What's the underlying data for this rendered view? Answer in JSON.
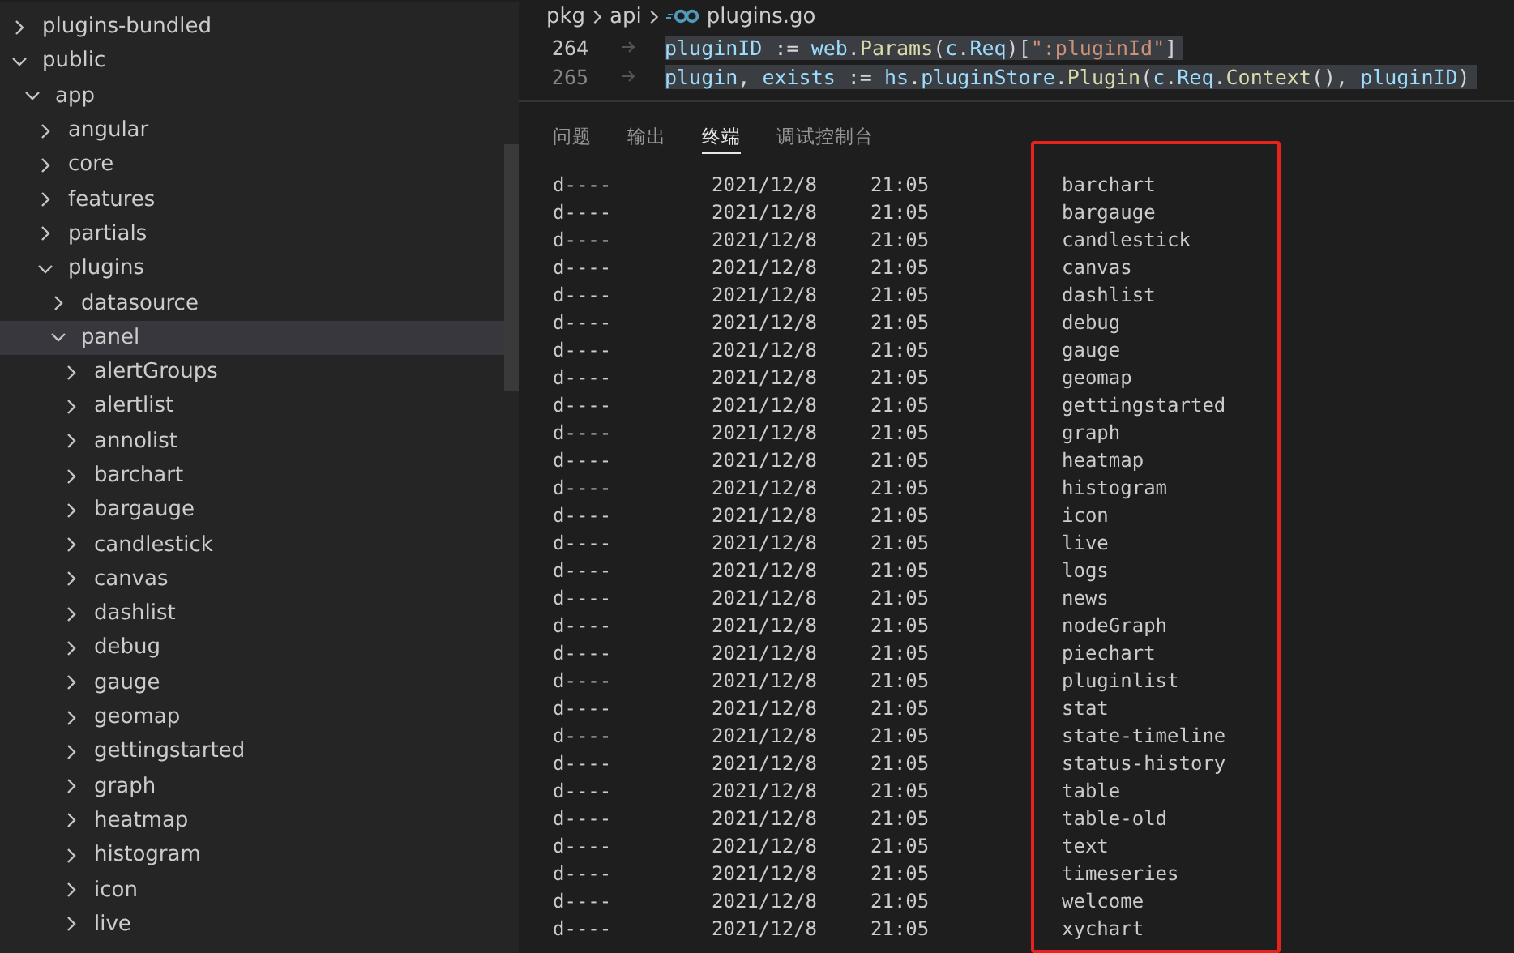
{
  "sidebar": {
    "tree": [
      {
        "label": "plugins-bundled",
        "expanded": false,
        "selected": false
      },
      {
        "label": "public",
        "expanded": true,
        "selected": false,
        "children": [
          {
            "label": "app",
            "expanded": true,
            "selected": false,
            "children": [
              {
                "label": "angular",
                "expanded": false,
                "selected": false
              },
              {
                "label": "core",
                "expanded": false,
                "selected": false
              },
              {
                "label": "features",
                "expanded": false,
                "selected": false
              },
              {
                "label": "partials",
                "expanded": false,
                "selected": false
              },
              {
                "label": "plugins",
                "expanded": true,
                "selected": false,
                "children": [
                  {
                    "label": "datasource",
                    "expanded": false,
                    "selected": false
                  },
                  {
                    "label": "panel",
                    "expanded": true,
                    "selected": true,
                    "children": [
                      {
                        "label": "alertGroups",
                        "expanded": false,
                        "selected": false
                      },
                      {
                        "label": "alertlist",
                        "expanded": false,
                        "selected": false
                      },
                      {
                        "label": "annolist",
                        "expanded": false,
                        "selected": false
                      },
                      {
                        "label": "barchart",
                        "expanded": false,
                        "selected": false
                      },
                      {
                        "label": "bargauge",
                        "expanded": false,
                        "selected": false
                      },
                      {
                        "label": "candlestick",
                        "expanded": false,
                        "selected": false
                      },
                      {
                        "label": "canvas",
                        "expanded": false,
                        "selected": false
                      },
                      {
                        "label": "dashlist",
                        "expanded": false,
                        "selected": false
                      },
                      {
                        "label": "debug",
                        "expanded": false,
                        "selected": false
                      },
                      {
                        "label": "gauge",
                        "expanded": false,
                        "selected": false
                      },
                      {
                        "label": "geomap",
                        "expanded": false,
                        "selected": false
                      },
                      {
                        "label": "gettingstarted",
                        "expanded": false,
                        "selected": false
                      },
                      {
                        "label": "graph",
                        "expanded": false,
                        "selected": false
                      },
                      {
                        "label": "heatmap",
                        "expanded": false,
                        "selected": false
                      },
                      {
                        "label": "histogram",
                        "expanded": false,
                        "selected": false
                      },
                      {
                        "label": "icon",
                        "expanded": false,
                        "selected": false
                      },
                      {
                        "label": "live",
                        "expanded": false,
                        "selected": false
                      }
                    ]
                  }
                ]
              }
            ]
          }
        ]
      }
    ]
  },
  "breadcrumb": [
    "pkg",
    "api",
    "plugins.go"
  ],
  "editor": {
    "lines": [
      {
        "number": "264",
        "tokens": [
          {
            "text": "pluginID",
            "kind": "variable"
          },
          {
            "text": " := ",
            "kind": "plain"
          },
          {
            "text": "web",
            "kind": "variable"
          },
          {
            "text": ".",
            "kind": "plain"
          },
          {
            "text": "Params",
            "kind": "function"
          },
          {
            "text": "(",
            "kind": "plain"
          },
          {
            "text": "c",
            "kind": "variable"
          },
          {
            "text": ".",
            "kind": "plain"
          },
          {
            "text": "Req",
            "kind": "variable"
          },
          {
            "text": ")[",
            "kind": "plain"
          },
          {
            "text": "\":pluginId\"",
            "kind": "string"
          },
          {
            "text": "]",
            "kind": "plain"
          }
        ]
      },
      {
        "number": "265",
        "tokens": [
          {
            "text": "plugin",
            "kind": "variable"
          },
          {
            "text": ", ",
            "kind": "plain"
          },
          {
            "text": "exists",
            "kind": "variable"
          },
          {
            "text": " := ",
            "kind": "plain"
          },
          {
            "text": "hs",
            "kind": "variable"
          },
          {
            "text": ".",
            "kind": "plain"
          },
          {
            "text": "pluginStore",
            "kind": "variable"
          },
          {
            "text": ".",
            "kind": "plain"
          },
          {
            "text": "Plugin",
            "kind": "function"
          },
          {
            "text": "(",
            "kind": "plain"
          },
          {
            "text": "c",
            "kind": "variable"
          },
          {
            "text": ".",
            "kind": "plain"
          },
          {
            "text": "Req",
            "kind": "variable"
          },
          {
            "text": ".",
            "kind": "plain"
          },
          {
            "text": "Context",
            "kind": "function"
          },
          {
            "text": "(), ",
            "kind": "plain"
          },
          {
            "text": "pluginID",
            "kind": "variable"
          },
          {
            "text": ")",
            "kind": "plain"
          }
        ]
      }
    ]
  },
  "panel": {
    "tabs": [
      {
        "label": "问题",
        "selected": false
      },
      {
        "label": "输出",
        "selected": false
      },
      {
        "label": "终端",
        "selected": true
      },
      {
        "label": "调试控制台",
        "selected": false
      }
    ],
    "terminal_rows": [
      {
        "mode": "d----",
        "date": "2021/12/8",
        "time": "21:05",
        "name": "barchart"
      },
      {
        "mode": "d----",
        "date": "2021/12/8",
        "time": "21:05",
        "name": "bargauge"
      },
      {
        "mode": "d----",
        "date": "2021/12/8",
        "time": "21:05",
        "name": "candlestick"
      },
      {
        "mode": "d----",
        "date": "2021/12/8",
        "time": "21:05",
        "name": "canvas"
      },
      {
        "mode": "d----",
        "date": "2021/12/8",
        "time": "21:05",
        "name": "dashlist"
      },
      {
        "mode": "d----",
        "date": "2021/12/8",
        "time": "21:05",
        "name": "debug"
      },
      {
        "mode": "d----",
        "date": "2021/12/8",
        "time": "21:05",
        "name": "gauge"
      },
      {
        "mode": "d----",
        "date": "2021/12/8",
        "time": "21:05",
        "name": "geomap"
      },
      {
        "mode": "d----",
        "date": "2021/12/8",
        "time": "21:05",
        "name": "gettingstarted"
      },
      {
        "mode": "d----",
        "date": "2021/12/8",
        "time": "21:05",
        "name": "graph"
      },
      {
        "mode": "d----",
        "date": "2021/12/8",
        "time": "21:05",
        "name": "heatmap"
      },
      {
        "mode": "d----",
        "date": "2021/12/8",
        "time": "21:05",
        "name": "histogram"
      },
      {
        "mode": "d----",
        "date": "2021/12/8",
        "time": "21:05",
        "name": "icon"
      },
      {
        "mode": "d----",
        "date": "2021/12/8",
        "time": "21:05",
        "name": "live"
      },
      {
        "mode": "d----",
        "date": "2021/12/8",
        "time": "21:05",
        "name": "logs"
      },
      {
        "mode": "d----",
        "date": "2021/12/8",
        "time": "21:05",
        "name": "news"
      },
      {
        "mode": "d----",
        "date": "2021/12/8",
        "time": "21:05",
        "name": "nodeGraph"
      },
      {
        "mode": "d----",
        "date": "2021/12/8",
        "time": "21:05",
        "name": "piechart"
      },
      {
        "mode": "d----",
        "date": "2021/12/8",
        "time": "21:05",
        "name": "pluginlist"
      },
      {
        "mode": "d----",
        "date": "2021/12/8",
        "time": "21:05",
        "name": "stat"
      },
      {
        "mode": "d----",
        "date": "2021/12/8",
        "time": "21:05",
        "name": "state-timeline"
      },
      {
        "mode": "d----",
        "date": "2021/12/8",
        "time": "21:05",
        "name": "status-history"
      },
      {
        "mode": "d----",
        "date": "2021/12/8",
        "time": "21:05",
        "name": "table"
      },
      {
        "mode": "d----",
        "date": "2021/12/8",
        "time": "21:05",
        "name": "table-old"
      },
      {
        "mode": "d----",
        "date": "2021/12/8",
        "time": "21:05",
        "name": "text"
      },
      {
        "mode": "d----",
        "date": "2021/12/8",
        "time": "21:05",
        "name": "timeseries"
      },
      {
        "mode": "d----",
        "date": "2021/12/8",
        "time": "21:05",
        "name": "welcome"
      },
      {
        "mode": "d----",
        "date": "2021/12/8",
        "time": "21:05",
        "name": "xychart"
      }
    ]
  }
}
